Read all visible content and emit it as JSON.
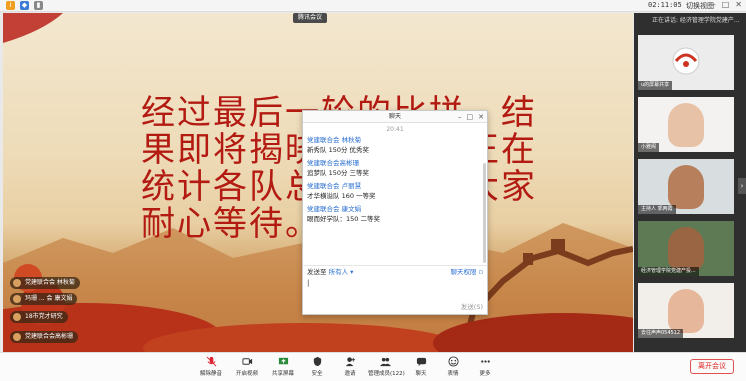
{
  "topbar": {
    "time": "02:11:05",
    "view_button": "切换视图",
    "window_controls": [
      "–",
      "□",
      "✕"
    ]
  },
  "shared_screen": {
    "speaker_tag": "腾讯会议",
    "slide_text": "经过最后一轮的比拼，结果即将揭晓。计分组正在统计各队总成绩，请大家耐心等待。"
  },
  "chips": [
    "党建联合会 林秋菊",
    "玛珊 ... 会 康文娟",
    "18市党才研究",
    "党建联合会高彬珊"
  ],
  "chat": {
    "title": "聊天",
    "time": "20:41",
    "messages": [
      {
        "sender": "党建联合会 林秋菊",
        "text": "新秀队  150分  优秀奖"
      },
      {
        "sender": "党建联合会高彬珊",
        "text": "追梦队 150分 三等奖"
      },
      {
        "sender": "党建联合会 卢丽慧",
        "text": "才华横溢队    160     一等奖"
      },
      {
        "sender": "党建联合会 康文娟",
        "text": "眼而好学队：150 二等奖"
      }
    ],
    "send_to_label": "发送至",
    "send_to_value": "所有人",
    "permission_label": "聊天权限",
    "send_button": "发送(S)"
  },
  "right_panel": {
    "header": "正在讲话: 经济管理学院党建产...",
    "tiles": [
      {
        "label": "u的屏幕共享",
        "face_color": "#ffffff"
      },
      {
        "label": "小雅阁",
        "face_color": "#e8c2a6"
      },
      {
        "label": "主持人 郭两霞",
        "face_color": "#b77f5b"
      },
      {
        "label": "经济管理学院党建产投...",
        "face_color": "#9a6542"
      },
      {
        "label": "去往声声054512",
        "face_color": "#e6b79a"
      }
    ]
  },
  "toolbar": {
    "buttons": [
      {
        "label": "解除静音",
        "icon": "microphone-icon",
        "color": "#d23"
      },
      {
        "label": "开启视频",
        "icon": "camera-icon",
        "color": "#333"
      },
      {
        "label": "共享屏幕",
        "icon": "share-screen-icon",
        "color": "#2a8a3a"
      },
      {
        "label": "安全",
        "icon": "shield-icon",
        "color": "#333"
      },
      {
        "label": "邀请",
        "icon": "invite-icon",
        "color": "#333"
      },
      {
        "label": "管理成员(122)",
        "icon": "members-icon",
        "color": "#333"
      },
      {
        "label": "聊天",
        "icon": "chat-icon",
        "color": "#333"
      },
      {
        "label": "表情",
        "icon": "emoji-icon",
        "color": "#333"
      },
      {
        "label": "更多",
        "icon": "more-icon",
        "color": "#333"
      }
    ],
    "leave_button": "离开会议"
  }
}
